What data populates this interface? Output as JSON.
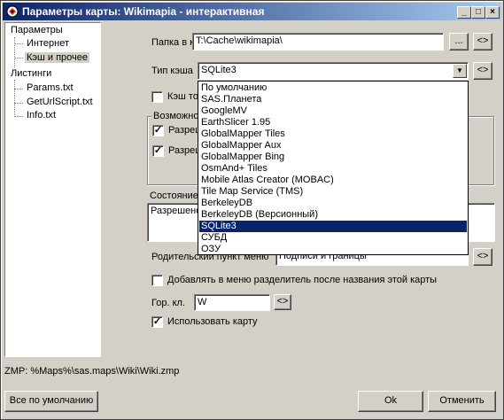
{
  "window": {
    "title": "Параметры карты: Wikimapia - интерактивная"
  },
  "tree": {
    "items": [
      {
        "label": "Параметры"
      },
      {
        "label": "Интернет"
      },
      {
        "label": "Кэш и прочее"
      },
      {
        "label": "Листинги"
      },
      {
        "label": "Params.txt"
      },
      {
        "label": "GetUrlScript.txt"
      },
      {
        "label": "Info.txt"
      }
    ]
  },
  "cache": {
    "folder_label": "Папка в кэше",
    "folder_value": "T:\\Cache\\wikimapia\\",
    "browse_label": "...",
    "reset_label": "<>",
    "type_label": "Тип кэша",
    "type_value": "SQLite3",
    "type_options": [
      "По умолчанию",
      "SAS.Планета",
      "GoogleMV",
      "EarthSlicer 1.95",
      "GlobalMapper Tiles",
      "GlobalMapper Aux",
      "GlobalMapper Bing",
      "OsmAnd+ Tiles",
      "Mobile Atlas Creator (MOBAC)",
      "Tile Map Service (TMS)",
      "BerkeleyDB",
      "BerkeleyDB (Версионный)",
      "SQLite3",
      "СУБД",
      "ОЗУ"
    ],
    "selected_index": 12,
    "only_checkbox_label": "Кэш то",
    "only_checked": false
  },
  "permissions": {
    "group_label": "Возможно",
    "items": [
      {
        "label": "Разреш",
        "checked": true
      },
      {
        "label": "Разреш",
        "checked": true
      }
    ]
  },
  "state": {
    "group_label": "Состояние",
    "text": "Разрешено"
  },
  "parent_menu": {
    "label": "Родительский пункт меню",
    "value": "Подписи и границы"
  },
  "separator_checkbox": {
    "label": "Добавлять в меню разделитель после названия этой карты",
    "checked": false
  },
  "hotkey": {
    "label": "Гор. кл.",
    "value": "W"
  },
  "use_map": {
    "label": "Использовать карту",
    "checked": true
  },
  "status": {
    "zmp": "ZMP:  %Maps%\\sas.maps\\Wiki\\Wiki.zmp"
  },
  "footer": {
    "defaults_label": "Все по умолчанию",
    "ok_label": "Ok",
    "cancel_label": "Отменить"
  },
  "colors": {
    "titlebar": "#0a246a",
    "selection": "#0a246a",
    "face": "#d4d0c8"
  }
}
